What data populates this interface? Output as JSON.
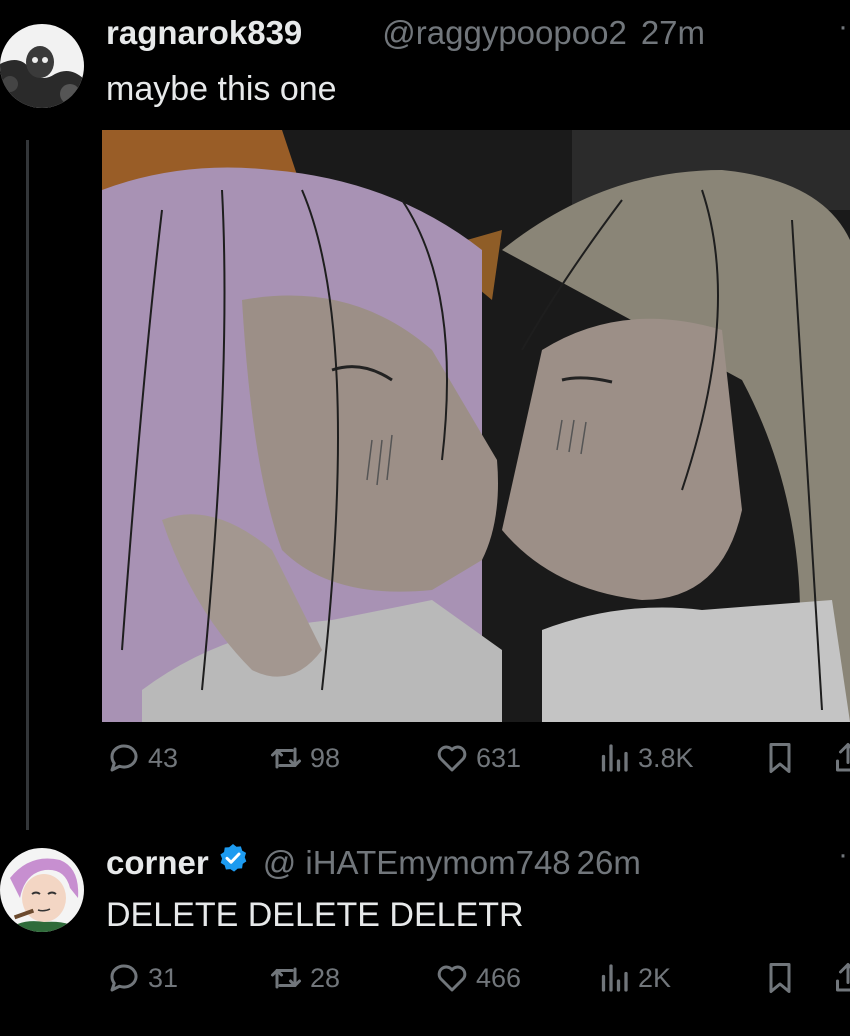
{
  "tweets": [
    {
      "display_name": "ragnarok839",
      "handle": "@raggypoopoo2",
      "time": "27m",
      "text": "maybe this one",
      "stats": {
        "replies": "43",
        "reposts": "98",
        "likes": "631",
        "views": "3.8K"
      }
    },
    {
      "display_name": "corner",
      "handle": "@ iHATEmymom748",
      "time": "26m",
      "text": "DELETE DELETE DELETR",
      "stats": {
        "replies": "31",
        "reposts": "28",
        "likes": "466",
        "views": "2K"
      }
    }
  ],
  "colors": {
    "background": "#000000",
    "primary_text": "#e7e9ea",
    "secondary_text": "#71767b",
    "verified": "#1d9bf0"
  },
  "icons": [
    "reply-icon",
    "repost-icon",
    "like-icon",
    "views-icon",
    "bookmark-icon",
    "share-icon",
    "verified-badge-icon",
    "more-icon"
  ]
}
